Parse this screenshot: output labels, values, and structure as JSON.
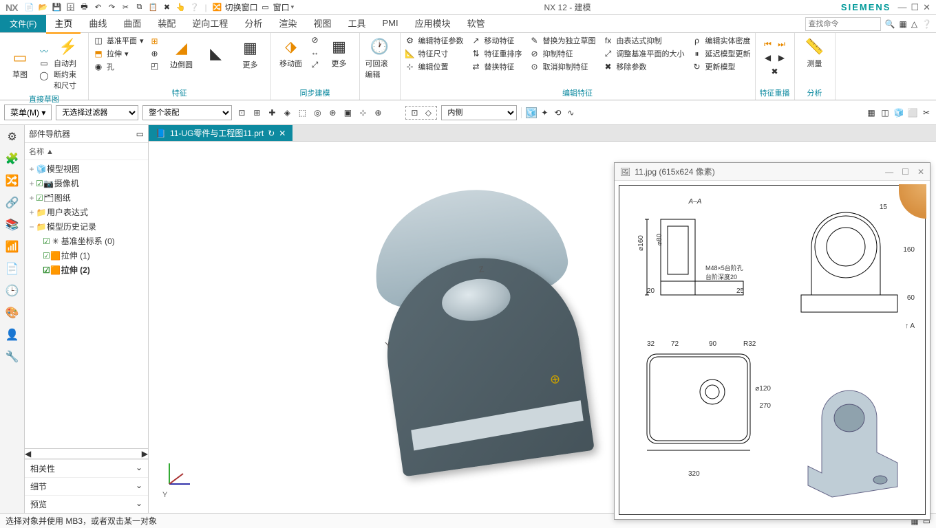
{
  "app": {
    "name": "NX",
    "title": "NX 12 - 建模",
    "brand": "SIEMENS"
  },
  "qat_items": [
    "新建",
    "打开",
    "保存",
    "全部保存",
    "打印",
    "撤销",
    "重做",
    "剪切",
    "复制",
    "粘贴",
    "删除",
    "触摸",
    "帮助"
  ],
  "qat_extra": {
    "switch_window": "切换窗口",
    "window": "窗口"
  },
  "search": {
    "placeholder": "查找命令"
  },
  "tabs": {
    "file": "文件(F)",
    "items": [
      "主页",
      "曲线",
      "曲面",
      "装配",
      "逆向工程",
      "分析",
      "渲染",
      "视图",
      "工具",
      "PMI",
      "应用模块",
      "软管"
    ],
    "active": 0
  },
  "ribbon": {
    "group_sketch": {
      "title": "直接草图",
      "sketch": "草图",
      "auto": "自动判断约束和尺寸"
    },
    "group_feature": {
      "title": "特征",
      "datum": "基准平面",
      "extrude": "拉伸",
      "hole": "孔",
      "edge_blend": "边倒圆",
      "more": "更多"
    },
    "group_sync": {
      "title": "同步建模",
      "move_face": "移动面",
      "more": "更多"
    },
    "group_rollback": {
      "rollback": "可回滚编辑"
    },
    "group_editfeat": {
      "title": "编辑特征",
      "items": [
        "编辑特征参数",
        "特征尺寸",
        "编辑位置",
        "移动特征",
        "特征重排序",
        "替换特征",
        "替换为独立草图",
        "抑制特征",
        "取消抑制特征",
        "由表达式抑制",
        "调整基准平面的大小",
        "移除参数",
        "编辑实体密度",
        "延迟模型更新",
        "更新模型"
      ]
    },
    "group_replay": {
      "title": "特征重播"
    },
    "group_measure": {
      "measure": "测量",
      "title": "分析"
    }
  },
  "toolbar2": {
    "menu": "菜单(M)",
    "filter": "无选择过滤器",
    "assembly": "整个装配",
    "inside": "内侧"
  },
  "navigator": {
    "title": "部件导航器",
    "col": "名称",
    "footer": [
      "相关性",
      "细节",
      "预览"
    ],
    "tree": [
      {
        "label": "模型视图",
        "icon": "🧊",
        "chk": false,
        "indent": 0,
        "exp": "+"
      },
      {
        "label": "摄像机",
        "icon": "📷",
        "chk": true,
        "indent": 0,
        "exp": "+"
      },
      {
        "label": "图纸",
        "icon": "🗂",
        "chk": true,
        "indent": 0,
        "exp": "+"
      },
      {
        "label": "用户表达式",
        "icon": "📁",
        "chk": false,
        "indent": 0,
        "exp": "+"
      },
      {
        "label": "模型历史记录",
        "icon": "📁",
        "chk": false,
        "indent": 0,
        "exp": "−"
      },
      {
        "label": "基准坐标系 (0)",
        "icon": "✳",
        "chk": true,
        "indent": 1,
        "exp": ""
      },
      {
        "label": "拉伸 (1)",
        "icon": "🟧",
        "chk": true,
        "indent": 1,
        "exp": ""
      },
      {
        "label": "拉伸 (2)",
        "icon": "🟧",
        "chk": true,
        "indent": 1,
        "exp": "",
        "bold": true
      }
    ]
  },
  "document": {
    "tab": "11-UG零件与工程图11.prt"
  },
  "axes": {
    "y": "Y",
    "z": "Z"
  },
  "image_viewer": {
    "title": "11.jpg  (615x624 像素)"
  },
  "drawing": {
    "section": "A–A",
    "arrowA": "A",
    "dims": {
      "d160": "⌀160",
      "d80": "⌀80",
      "t20": "20",
      "h160": "160",
      "h60": "60",
      "h25": "25",
      "note": "M48×5台阶孔\n台阶深度20",
      "w32": "32",
      "w72": "72",
      "w90": "90",
      "r32": "R32",
      "d120": "⌀120",
      "h270": "270",
      "w320": "320",
      "t15": "15"
    }
  },
  "status": {
    "text": "选择对象并使用 MB3，或者双击某一对象"
  }
}
